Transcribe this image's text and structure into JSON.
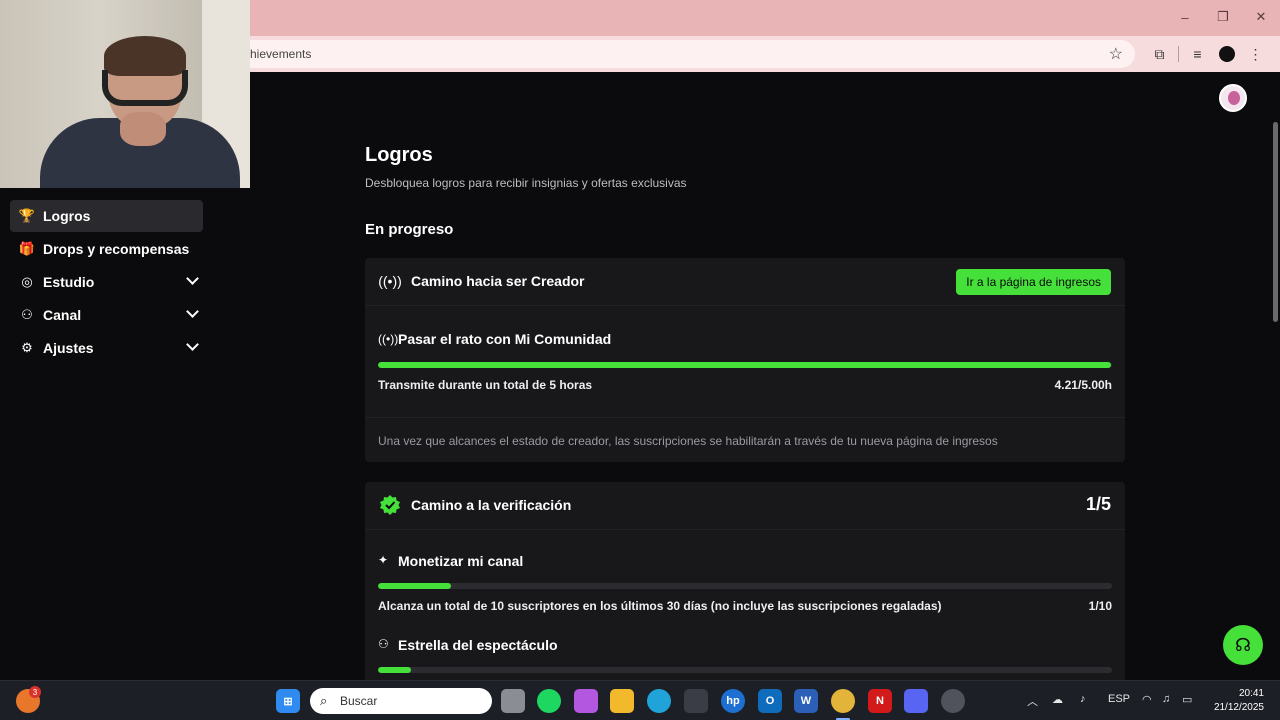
{
  "browser": {
    "url": "hievements",
    "window_controls": [
      "–",
      "❐",
      "✕"
    ]
  },
  "sidebar": {
    "items": [
      {
        "label": "Logros",
        "icon": "trophy-icon",
        "glyph": "🏆",
        "active": true
      },
      {
        "label": "Drops y recompensas",
        "icon": "gift-icon",
        "glyph": "🎁",
        "expandable": false
      },
      {
        "label": "Estudio",
        "icon": "studio-icon",
        "glyph": "◎",
        "expandable": true
      },
      {
        "label": "Canal",
        "icon": "channel-icon",
        "glyph": "⚇",
        "expandable": true
      },
      {
        "label": "Ajustes",
        "icon": "gear-icon",
        "glyph": "⚙",
        "expandable": true
      }
    ]
  },
  "main": {
    "title": "Logros",
    "subtitle": "Desbloquea logros para recibir insignias y ofertas exclusivas",
    "section_title": "En progreso",
    "cards": [
      {
        "title": "Camino hacia ser Creador",
        "button_label": "Ir a la página de ingresos",
        "task": {
          "title": "Pasar el rato con Mi Comunidad",
          "description": "Transmite durante un total de 5 horas",
          "value_label": "4.21/5.00h",
          "progress": 0.999
        },
        "note": "Una vez que alcances el estado de creador, las suscripciones se habilitarán a través de tu nueva página de ingresos"
      },
      {
        "title": "Camino a la verificación",
        "count": "1/5",
        "tasks": [
          {
            "title": "Monetizar mi canal",
            "description": "Alcanza un total de 10 suscriptores en los últimos 30 días (no incluye las suscripciones regaladas)",
            "value_label": "1/10",
            "progress": 0.1
          },
          {
            "title": "Estrella del espectáculo",
            "progress": 0.045
          }
        ]
      }
    ]
  },
  "colors": {
    "accent": "#45e03a",
    "background": "#0b0b0d",
    "card": "#18181b",
    "titlebar": "#e8b4b6"
  },
  "taskbar": {
    "search_placeholder": "Buscar",
    "notification_badge": "3",
    "language": "ESP",
    "time": "20:41",
    "date": "21/12/2025"
  }
}
